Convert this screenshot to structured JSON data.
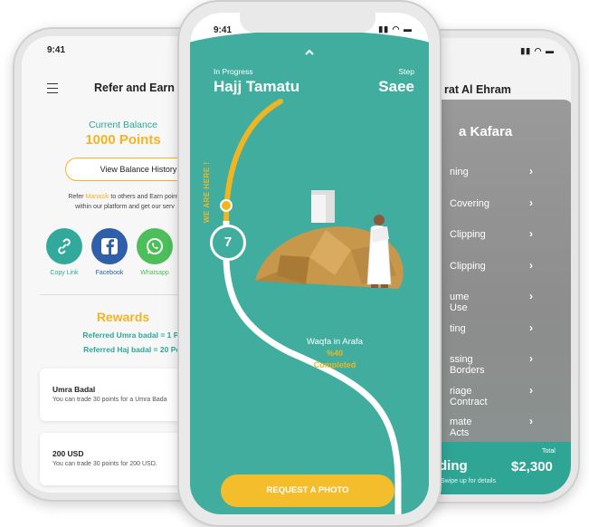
{
  "status_time": "9:41",
  "refer_screen": {
    "title": "Refer and Earn",
    "balance_label": "Current Balance",
    "balance_value": "1000 Points",
    "history_button": "View Balance History",
    "refer_text_prefix": "Refer ",
    "refer_text_brand": "Manasik",
    "refer_text_suffix": " to others and Earn points",
    "refer_text_line2": "within our platform and get our serv",
    "share": [
      {
        "label": "Copy Link",
        "color": "#33a99b",
        "icon": "link-icon",
        "label_color": "#2aa89a"
      },
      {
        "label": "Facebook",
        "color": "#2f5fa8",
        "icon": "facebook-icon",
        "label_color": "#2f5fa8"
      },
      {
        "label": "Whatsapp",
        "color": "#4cbe5a",
        "icon": "whatsapp-icon",
        "label_color": "#4cbe5a"
      }
    ],
    "rewards_title": "Rewards",
    "reward_lines": [
      "Referred Umra badal = 1 Po",
      "Referred Haj badal = 20 Poi"
    ],
    "cards": [
      {
        "title": "Umra Badal",
        "desc": "You can trade 30 points for a Umra Bada"
      },
      {
        "title": "200 USD",
        "desc": "You can trade 30 points for 200 USD."
      }
    ]
  },
  "progress_screen": {
    "in_progress_label": "In Progress",
    "trip_name": "Hajj Tamatu",
    "step_label": "Step",
    "step_name": "Saee",
    "here_label": "WE ARE HERE !",
    "step_number": "7",
    "current_step_title": "Waqfa in Arafa",
    "percent": "%40",
    "completed_label": "Completed",
    "request_button": "REQUEST A PHOTO"
  },
  "ehram_screen": {
    "title": "rat Al Ehram",
    "panel_title": "a Kafara",
    "items": [
      "ning",
      "Covering",
      "Clipping",
      "Clipping",
      "ume Use",
      "ting",
      "ssing Borders",
      "riage Contract",
      "mate Acts"
    ],
    "bottom_label": "ding",
    "total_label": "Total",
    "total_amount": "$2,300",
    "swipe_hint": "Swipe up for details"
  },
  "colors": {
    "teal": "#40ad9e",
    "gold": "#f2b522",
    "white": "#ffffff"
  }
}
